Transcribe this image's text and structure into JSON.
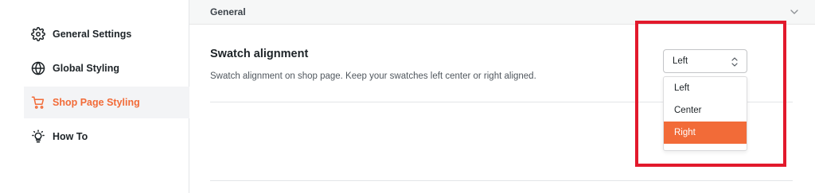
{
  "sidebar": {
    "items": [
      {
        "label": "General Settings",
        "icon": "gear-icon"
      },
      {
        "label": "Global Styling",
        "icon": "globe-icon"
      },
      {
        "label": "Shop Page Styling",
        "icon": "cart-icon",
        "active": true
      },
      {
        "label": "How To",
        "icon": "lightbulb-icon"
      }
    ]
  },
  "section": {
    "title": "General",
    "chevron_icon": "chevron-down-icon"
  },
  "setting": {
    "title": "Swatch alignment",
    "description": "Swatch alignment on shop page. Keep your swatches left center or right aligned.",
    "select": {
      "value": "Left",
      "options": [
        "Left",
        "Center",
        "Right"
      ],
      "hovered_option": "Right"
    }
  },
  "colors": {
    "accent": "#f26b38",
    "highlight_box": "#e2192c"
  }
}
